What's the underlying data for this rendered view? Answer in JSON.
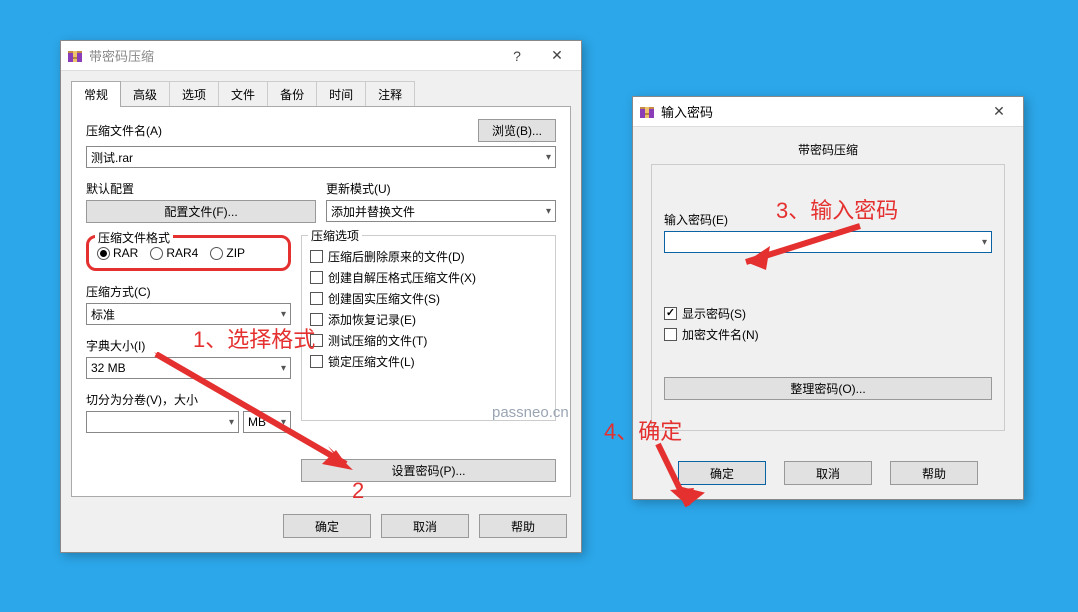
{
  "main": {
    "title": "带密码压缩",
    "tabs": [
      "常规",
      "高级",
      "选项",
      "文件",
      "备份",
      "时间",
      "注释"
    ],
    "filename_label": "压缩文件名(A)",
    "filename_value": "测试.rar",
    "browse": "浏览(B)...",
    "default_profile_label": "默认配置",
    "profiles_btn": "配置文件(F)...",
    "update_mode_label": "更新模式(U)",
    "update_mode_value": "添加并替换文件",
    "format_label": "压缩文件格式",
    "formats": {
      "rar": "RAR",
      "rar4": "RAR4",
      "zip": "ZIP"
    },
    "comp_options_label": "压缩选项",
    "opts": [
      "压缩后删除原来的文件(D)",
      "创建自解压格式压缩文件(X)",
      "创建固实压缩文件(S)",
      "添加恢复记录(E)",
      "测试压缩的文件(T)",
      "锁定压缩文件(L)"
    ],
    "method_label": "压缩方式(C)",
    "method_value": "标准",
    "dict_label": "字典大小(I)",
    "dict_value": "32 MB",
    "split_label": "切分为分卷(V)，大小",
    "split_unit": "MB",
    "set_password_btn": "设置密码(P)...",
    "ok": "确定",
    "cancel": "取消",
    "help": "帮助"
  },
  "pwd": {
    "title": "输入密码",
    "caption": "带密码压缩",
    "field_label": "输入密码(E)",
    "show_password": "显示密码(S)",
    "encrypt_names": "加密文件名(N)",
    "organize_btn": "整理密码(O)...",
    "ok": "确定",
    "cancel": "取消",
    "help": "帮助"
  },
  "annot": {
    "a1": "1、选择格式",
    "a2": "2",
    "a3": "3、输入密码",
    "a4": "4、确定"
  },
  "watermark": "passneo.cn"
}
